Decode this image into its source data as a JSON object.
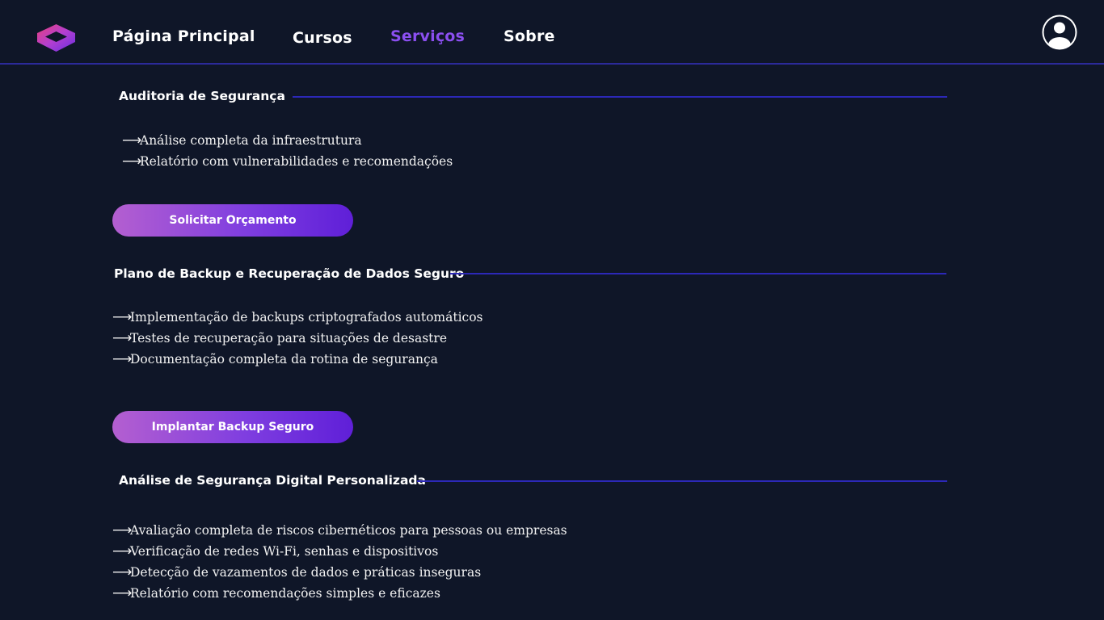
{
  "nav": {
    "logo_icon": "hexagon-logo-icon",
    "items": [
      {
        "label": "Página Principal",
        "active": false
      },
      {
        "label": "Cursos",
        "active": false
      },
      {
        "label": "Serviços",
        "active": true
      },
      {
        "label": "Sobre",
        "active": false
      }
    ],
    "avatar_icon": "user-avatar-icon"
  },
  "colors": {
    "background": "#0f1628",
    "accent": "#8b4ff0",
    "rule": "#2c28b8",
    "button_gradient_start": "#b45fd0",
    "button_gradient_end": "#5f1fd8"
  },
  "services": [
    {
      "title": "Auditoria de Segurança",
      "items": [
        "Análise completa da infraestrutura",
        "Relatório com vulnerabilidades e recomendações"
      ],
      "button": "Solicitar Orçamento"
    },
    {
      "title": "Plano de Backup e Recuperação de Dados Seguro",
      "items": [
        "Implementação de backups criptografados automáticos",
        "Testes de recuperação para situações de desastre",
        "Documentação completa da rotina de segurança"
      ],
      "button": "Implantar Backup Seguro"
    },
    {
      "title": "Análise de Segurança Digital Personalizada",
      "items": [
        "Avaliação completa de riscos cibernéticos para pessoas ou empresas",
        "Verificação de redes Wi-Fi, senhas e dispositivos",
        "Detecção de vazamentos de dados e práticas inseguras",
        "Relatório com recomendações simples e eficazes"
      ]
    }
  ]
}
